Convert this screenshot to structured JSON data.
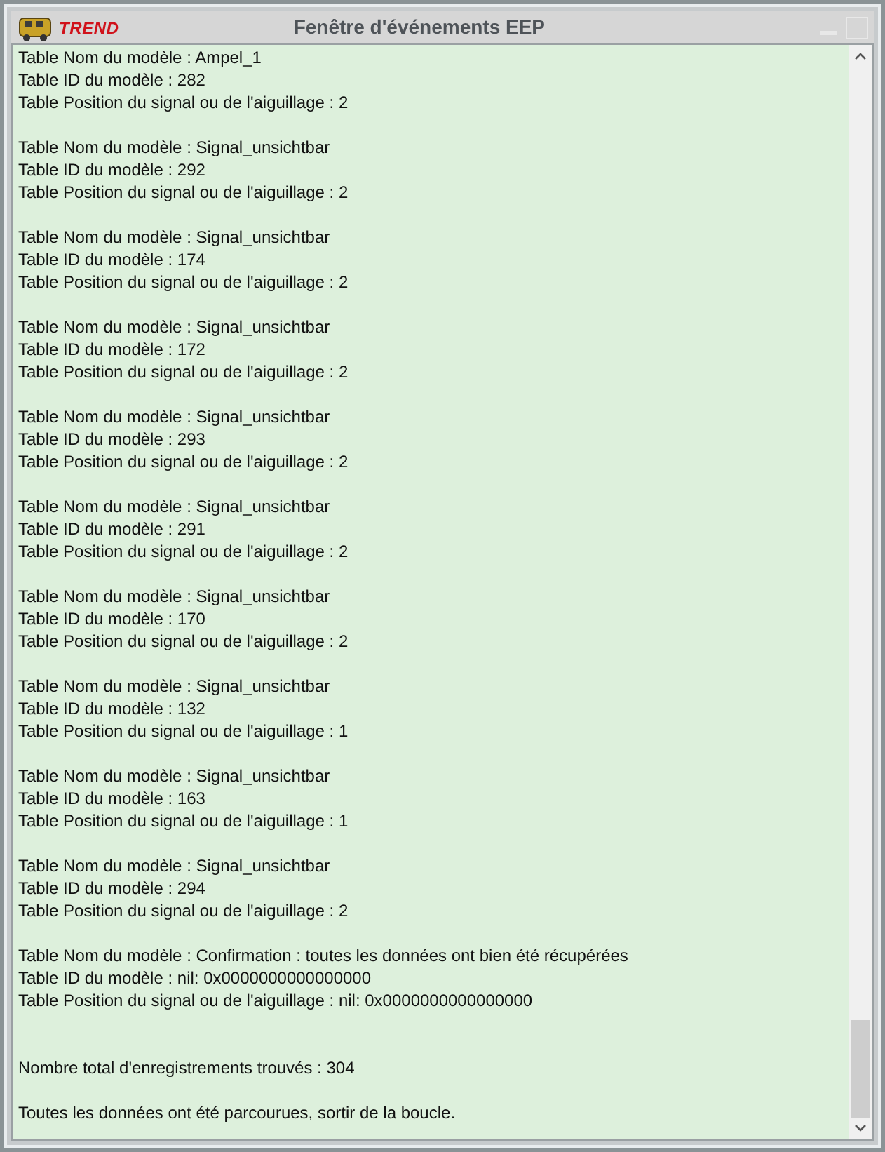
{
  "window": {
    "brand": "TREND",
    "title": "Fenêtre d'événements EEP"
  },
  "records": [
    {
      "lines": [
        "Table Nom du modèle : Ampel_1",
        "Table ID du modèle : 282",
        "Table Position du signal ou de l'aiguillage : 2"
      ]
    },
    {
      "lines": [
        "Table Nom du modèle : Signal_unsichtbar",
        "Table ID du modèle : 292",
        "Table Position du signal ou de l'aiguillage : 2"
      ]
    },
    {
      "lines": [
        "Table Nom du modèle : Signal_unsichtbar",
        "Table ID du modèle : 174",
        "Table Position du signal ou de l'aiguillage : 2"
      ]
    },
    {
      "lines": [
        "Table Nom du modèle : Signal_unsichtbar",
        "Table ID du modèle : 172",
        "Table Position du signal ou de l'aiguillage : 2"
      ]
    },
    {
      "lines": [
        "Table Nom du modèle : Signal_unsichtbar",
        "Table ID du modèle : 293",
        "Table Position du signal ou de l'aiguillage : 2"
      ]
    },
    {
      "lines": [
        "Table Nom du modèle : Signal_unsichtbar",
        "Table ID du modèle : 291",
        "Table Position du signal ou de l'aiguillage : 2"
      ]
    },
    {
      "lines": [
        "Table Nom du modèle : Signal_unsichtbar",
        "Table ID du modèle : 170",
        "Table Position du signal ou de l'aiguillage : 2"
      ]
    },
    {
      "lines": [
        "Table Nom du modèle : Signal_unsichtbar",
        "Table ID du modèle : 132",
        "Table Position du signal ou de l'aiguillage : 1"
      ]
    },
    {
      "lines": [
        "Table Nom du modèle : Signal_unsichtbar",
        "Table ID du modèle : 163",
        "Table Position du signal ou de l'aiguillage : 1"
      ]
    },
    {
      "lines": [
        "Table Nom du modèle : Signal_unsichtbar",
        "Table ID du modèle : 294",
        "Table Position du signal ou de l'aiguillage : 2"
      ]
    },
    {
      "lines": [
        "Table Nom du modèle : Confirmation : toutes les données ont bien été récupérées",
        "Table ID du modèle : nil: 0x0000000000000000",
        "Table Position du signal ou de l'aiguillage : nil: 0x0000000000000000"
      ]
    }
  ],
  "summary": {
    "lines": [
      "Nombre total d'enregistrements trouvés : 304",
      "Toutes les données ont été parcourues, sortir de la boucle."
    ]
  }
}
